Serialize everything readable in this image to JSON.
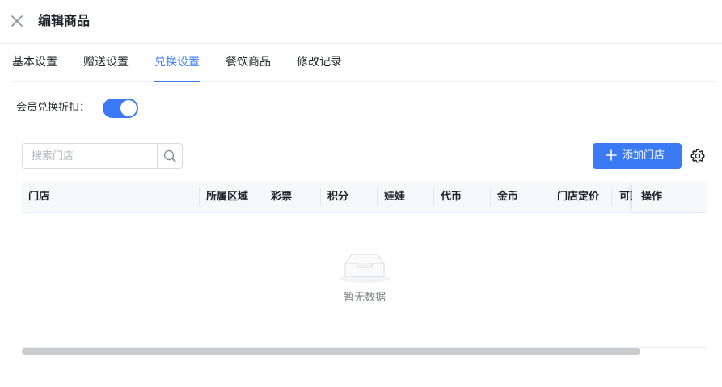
{
  "header": {
    "title": "编辑商品",
    "close_icon": "close-icon"
  },
  "tabs": [
    {
      "label": "基本设置",
      "active": false
    },
    {
      "label": "赠送设置",
      "active": false
    },
    {
      "label": "兑换设置",
      "active": true
    },
    {
      "label": "餐饮商品",
      "active": false
    },
    {
      "label": "修改记录",
      "active": false
    }
  ],
  "discount": {
    "label": "会员兑换折扣：",
    "enabled": true
  },
  "search": {
    "placeholder": "搜索门店",
    "value": "",
    "icon": "search-icon"
  },
  "toolbar": {
    "add_label": "添加门店",
    "add_icon": "plus-icon",
    "settings_icon": "gear-icon"
  },
  "table": {
    "columns": [
      "门店",
      "所属区域",
      "彩票",
      "积分",
      "娃娃",
      "代币",
      "金币",
      "门店定价",
      "可回",
      "操作"
    ],
    "rows": [],
    "empty_text": "暂无数据",
    "empty_icon": "empty-box-icon"
  },
  "colors": {
    "accent": "#3a7af5",
    "header_bg": "#f7f8fa",
    "border": "#ebeef5"
  }
}
